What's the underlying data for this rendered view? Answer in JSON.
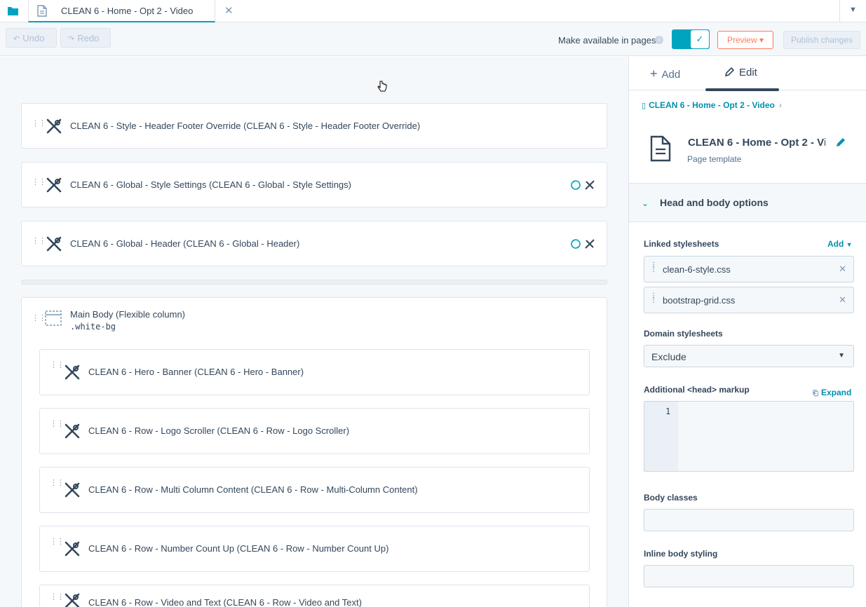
{
  "tabbar": {
    "tab_title": "CLEAN 6 - Home - Opt 2 - Video",
    "close_glyph": "✕",
    "menu_glyph": "▼"
  },
  "toolbar": {
    "undo_label": "Undo",
    "redo_label": "Redo",
    "available_label": "Make available in pages",
    "available_toggle": true,
    "preview_label": "Preview ▾",
    "publish_label": "Publish changes"
  },
  "modules": [
    {
      "label": "CLEAN 6 - Style - Header Footer Override (CLEAN 6 - Style - Header Footer Override)",
      "global": false
    },
    {
      "label": "CLEAN 6 - Global - Style Settings (CLEAN 6 - Global - Style Settings)",
      "global": true
    },
    {
      "label": "CLEAN 6 - Global - Header (CLEAN 6 - Global - Header)",
      "global": true
    }
  ],
  "main_body": {
    "title": "Main Body (Flexible column)",
    "class": ".white-bg",
    "children": [
      "CLEAN 6 - Hero - Banner (CLEAN 6 - Hero - Banner)",
      "CLEAN 6 - Row - Logo Scroller (CLEAN 6 - Row - Logo Scroller)",
      "CLEAN 6 - Row - Multi Column Content (CLEAN 6 - Row - Multi-Column Content)",
      "CLEAN 6 - Row - Number Count Up (CLEAN 6 - Row - Number Count Up)",
      "CLEAN 6 - Row - Video and Text (CLEAN 6 - Row - Video and Text)"
    ]
  },
  "panel": {
    "tabs": {
      "add": "Add",
      "edit": "Edit",
      "active": "edit"
    },
    "breadcrumb": "CLEAN 6 - Home - Opt 2 - Video",
    "template_name": "CLEAN 6 - Home - Opt 2 - Video",
    "template_type": "Page template",
    "section_title": "Head and body options",
    "linked_label": "Linked stylesheets",
    "add_label": "Add",
    "stylesheets": [
      "clean-6-style.css",
      "bootstrap-grid.css"
    ],
    "domain_label": "Domain stylesheets",
    "domain_value": "Exclude",
    "head_markup_label": "Additional <head> markup",
    "expand_label": "Expand",
    "line_number": "1",
    "body_classes_label": "Body classes",
    "inline_styling_label": "Inline body styling"
  },
  "colors": {
    "accent": "#00a4bd",
    "link": "#0091ae",
    "orange": "#ff7a59",
    "text": "#33475b"
  }
}
